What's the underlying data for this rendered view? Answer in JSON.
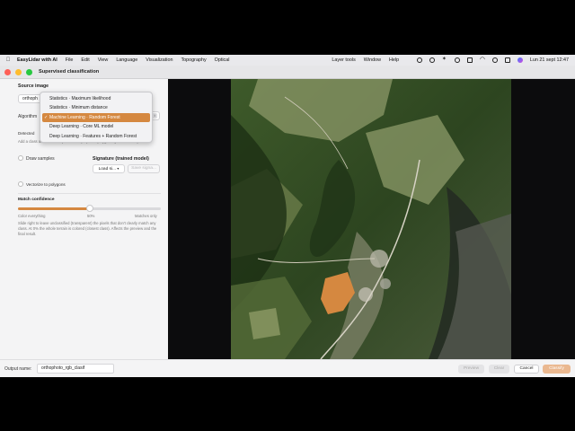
{
  "menubar": {
    "app_name": "EasyLidar with AI",
    "items": [
      "File",
      "Edit",
      "View",
      "Language",
      "Visualization",
      "Topography",
      "Optical"
    ],
    "right_items": [
      "Layer tools",
      "Window",
      "Help"
    ],
    "clock": "Lun 21 sept  12:47"
  },
  "window": {
    "title": "Supervised classification"
  },
  "source": {
    "heading": "Source image",
    "file_value": "orthoph",
    "algorithm_label": "Algorithm",
    "detected_label": "Detected",
    "hint": "Add a class and draw samples below (or pick a polygon layer's attribute)."
  },
  "algorithm_menu": {
    "options": [
      "Statistics · Maximum likelihood",
      "Statistics · Minimum distance",
      "Machine Learning · Random Forest",
      "Deep Learning · Core ML model",
      "Deep Learning · Features + Random Forest"
    ],
    "selected_index": 2
  },
  "samples": {
    "draw_samples_label": "Draw samples",
    "signature_heading": "Signature (trained model)",
    "load_button": "Load si...",
    "save_button": "Save signa...",
    "vectorize_label": "Vectorize to polygons"
  },
  "match": {
    "heading": "Match confidence",
    "min_label": "Color everything",
    "value_label": "50%",
    "max_label": "Matches only",
    "value": 0.5,
    "description": "Slide right to leave unclassified (transparent) the pixels that don't clearly match any class. At 0% the whole terrain is colored (closest class). Affects the preview and the final result."
  },
  "bottom": {
    "output_label": "Output name:",
    "output_value": "orthophoto_rgb_clasif",
    "preview": "Preview",
    "clear": "Clear",
    "cancel": "Cancel",
    "classify": "Classify"
  },
  "colors": {
    "accent": "#d58840",
    "menubar": "#e9e9ec",
    "panel": "#f4f4f5"
  }
}
